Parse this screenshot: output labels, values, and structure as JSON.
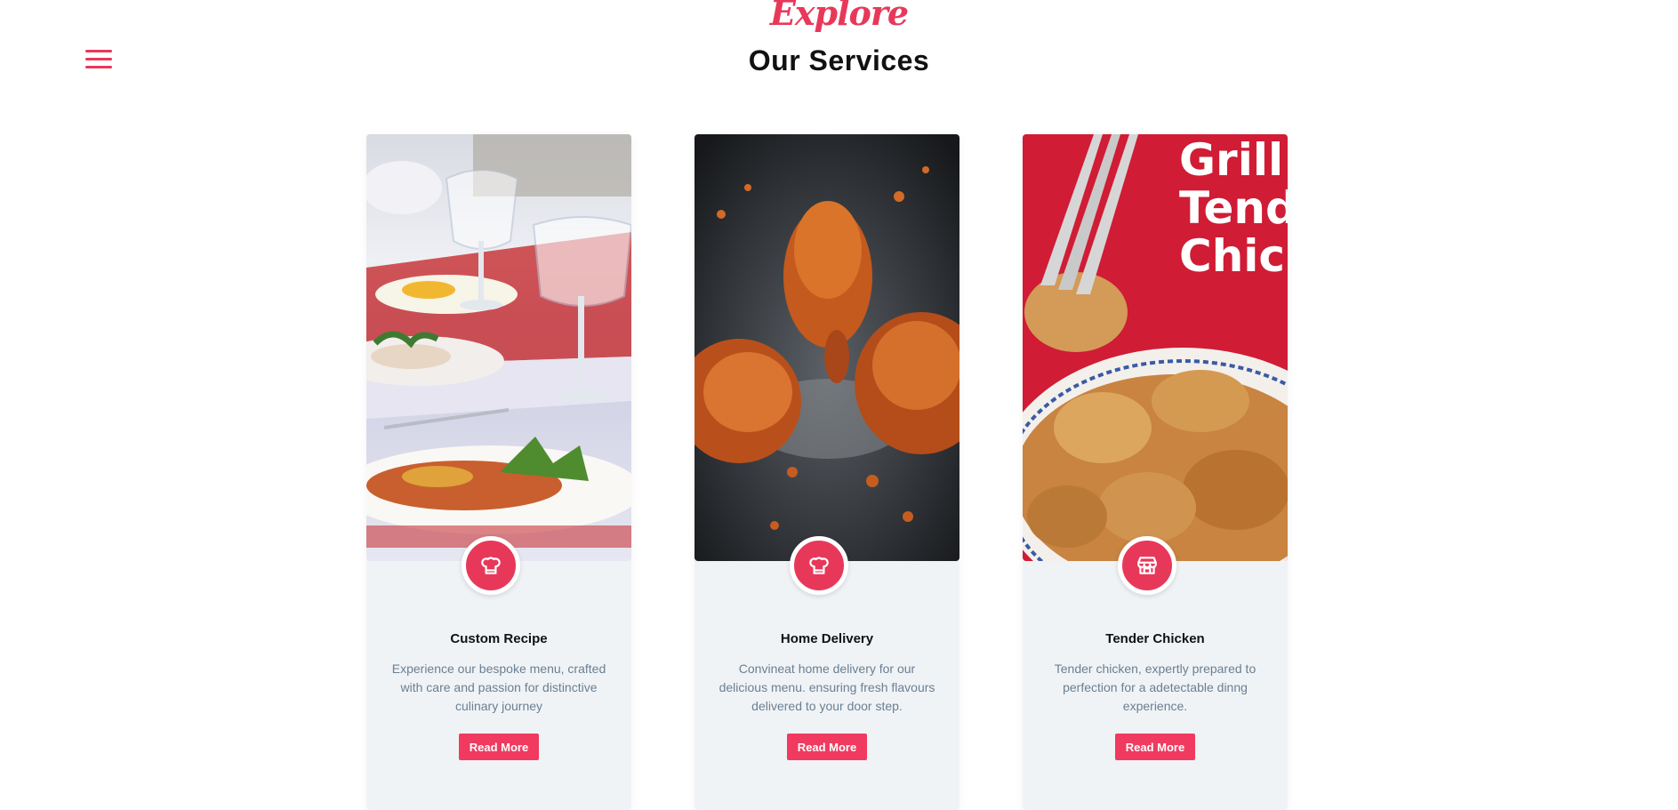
{
  "header": {
    "eyebrow": "Explore",
    "title": "Our Services"
  },
  "accent_color": "#e8385a",
  "cards": [
    {
      "title": "Custom Recipe",
      "description": "Experience our bespoke menu, crafted with care and passion for distinctive culinary journey",
      "button_label": "Read More",
      "icon": "chef-hat-icon",
      "image": "restaurant-table-photo"
    },
    {
      "title": "Home Delivery",
      "description": "Convineat home delivery for our delicious menu. ensuring fresh flavours delivered to your door step.",
      "button_label": "Read More",
      "icon": "chef-hat-icon",
      "image": "fried-chicken-wings-photo"
    },
    {
      "title": "Tender Chicken",
      "description": "Tender chicken, expertly prepared to perfection for a adetectable dinng experience.",
      "button_label": "Read More",
      "icon": "storefront-icon",
      "image": "grilled-tender-chicken-photo",
      "image_text": [
        "Grill",
        "Tend",
        "Chic"
      ]
    }
  ]
}
